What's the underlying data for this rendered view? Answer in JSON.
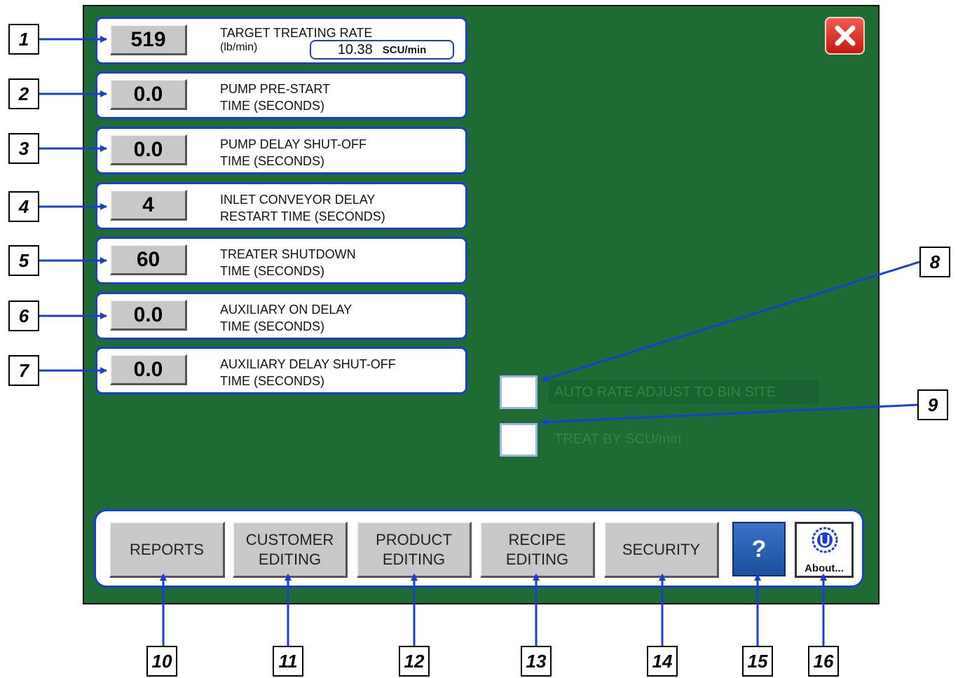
{
  "params": [
    {
      "value": "519",
      "label": "TARGET TREATING RATE",
      "sub": "(lb/min)"
    },
    {
      "value": "0.0",
      "label": "PUMP PRE-START",
      "label2": "TIME (SECONDS)"
    },
    {
      "value": "0.0",
      "label": "PUMP DELAY SHUT-OFF",
      "label2": "TIME (SECONDS)"
    },
    {
      "value": "4",
      "label": "INLET CONVEYOR DELAY",
      "label2": "RESTART TIME (SECONDS)"
    },
    {
      "value": "60",
      "label": "TREATER SHUTDOWN",
      "label2": "TIME (SECONDS)"
    },
    {
      "value": "0.0",
      "label": "AUXILIARY ON DELAY",
      "label2": "TIME (SECONDS)"
    },
    {
      "value": "0.0",
      "label": "AUXILIARY DELAY SHUT-OFF",
      "label2": "TIME (SECONDS)"
    }
  ],
  "scu": {
    "value": "10.38",
    "unit": "SCU/min"
  },
  "checkboxes": [
    {
      "label": "AUTO RATE ADJUST TO BIN SITE",
      "checked": false
    },
    {
      "label": "TREAT BY SCU/min",
      "checked": false
    }
  ],
  "nav": {
    "reports": "REPORTS",
    "customer_1": "CUSTOMER",
    "customer_2": "EDITING",
    "product_1": "PRODUCT",
    "product_2": "EDITING",
    "recipe_1": "RECIPE",
    "recipe_2": "EDITING",
    "security": "SECURITY",
    "help": "?",
    "about": "About..."
  },
  "callouts": [
    "1",
    "2",
    "3",
    "4",
    "5",
    "6",
    "7",
    "8",
    "9",
    "10",
    "11",
    "12",
    "13",
    "14",
    "15",
    "16"
  ],
  "colors": {
    "background": "#1e6b34",
    "panel_border": "#1a3fd0",
    "arrow": "#1a3fd0"
  }
}
